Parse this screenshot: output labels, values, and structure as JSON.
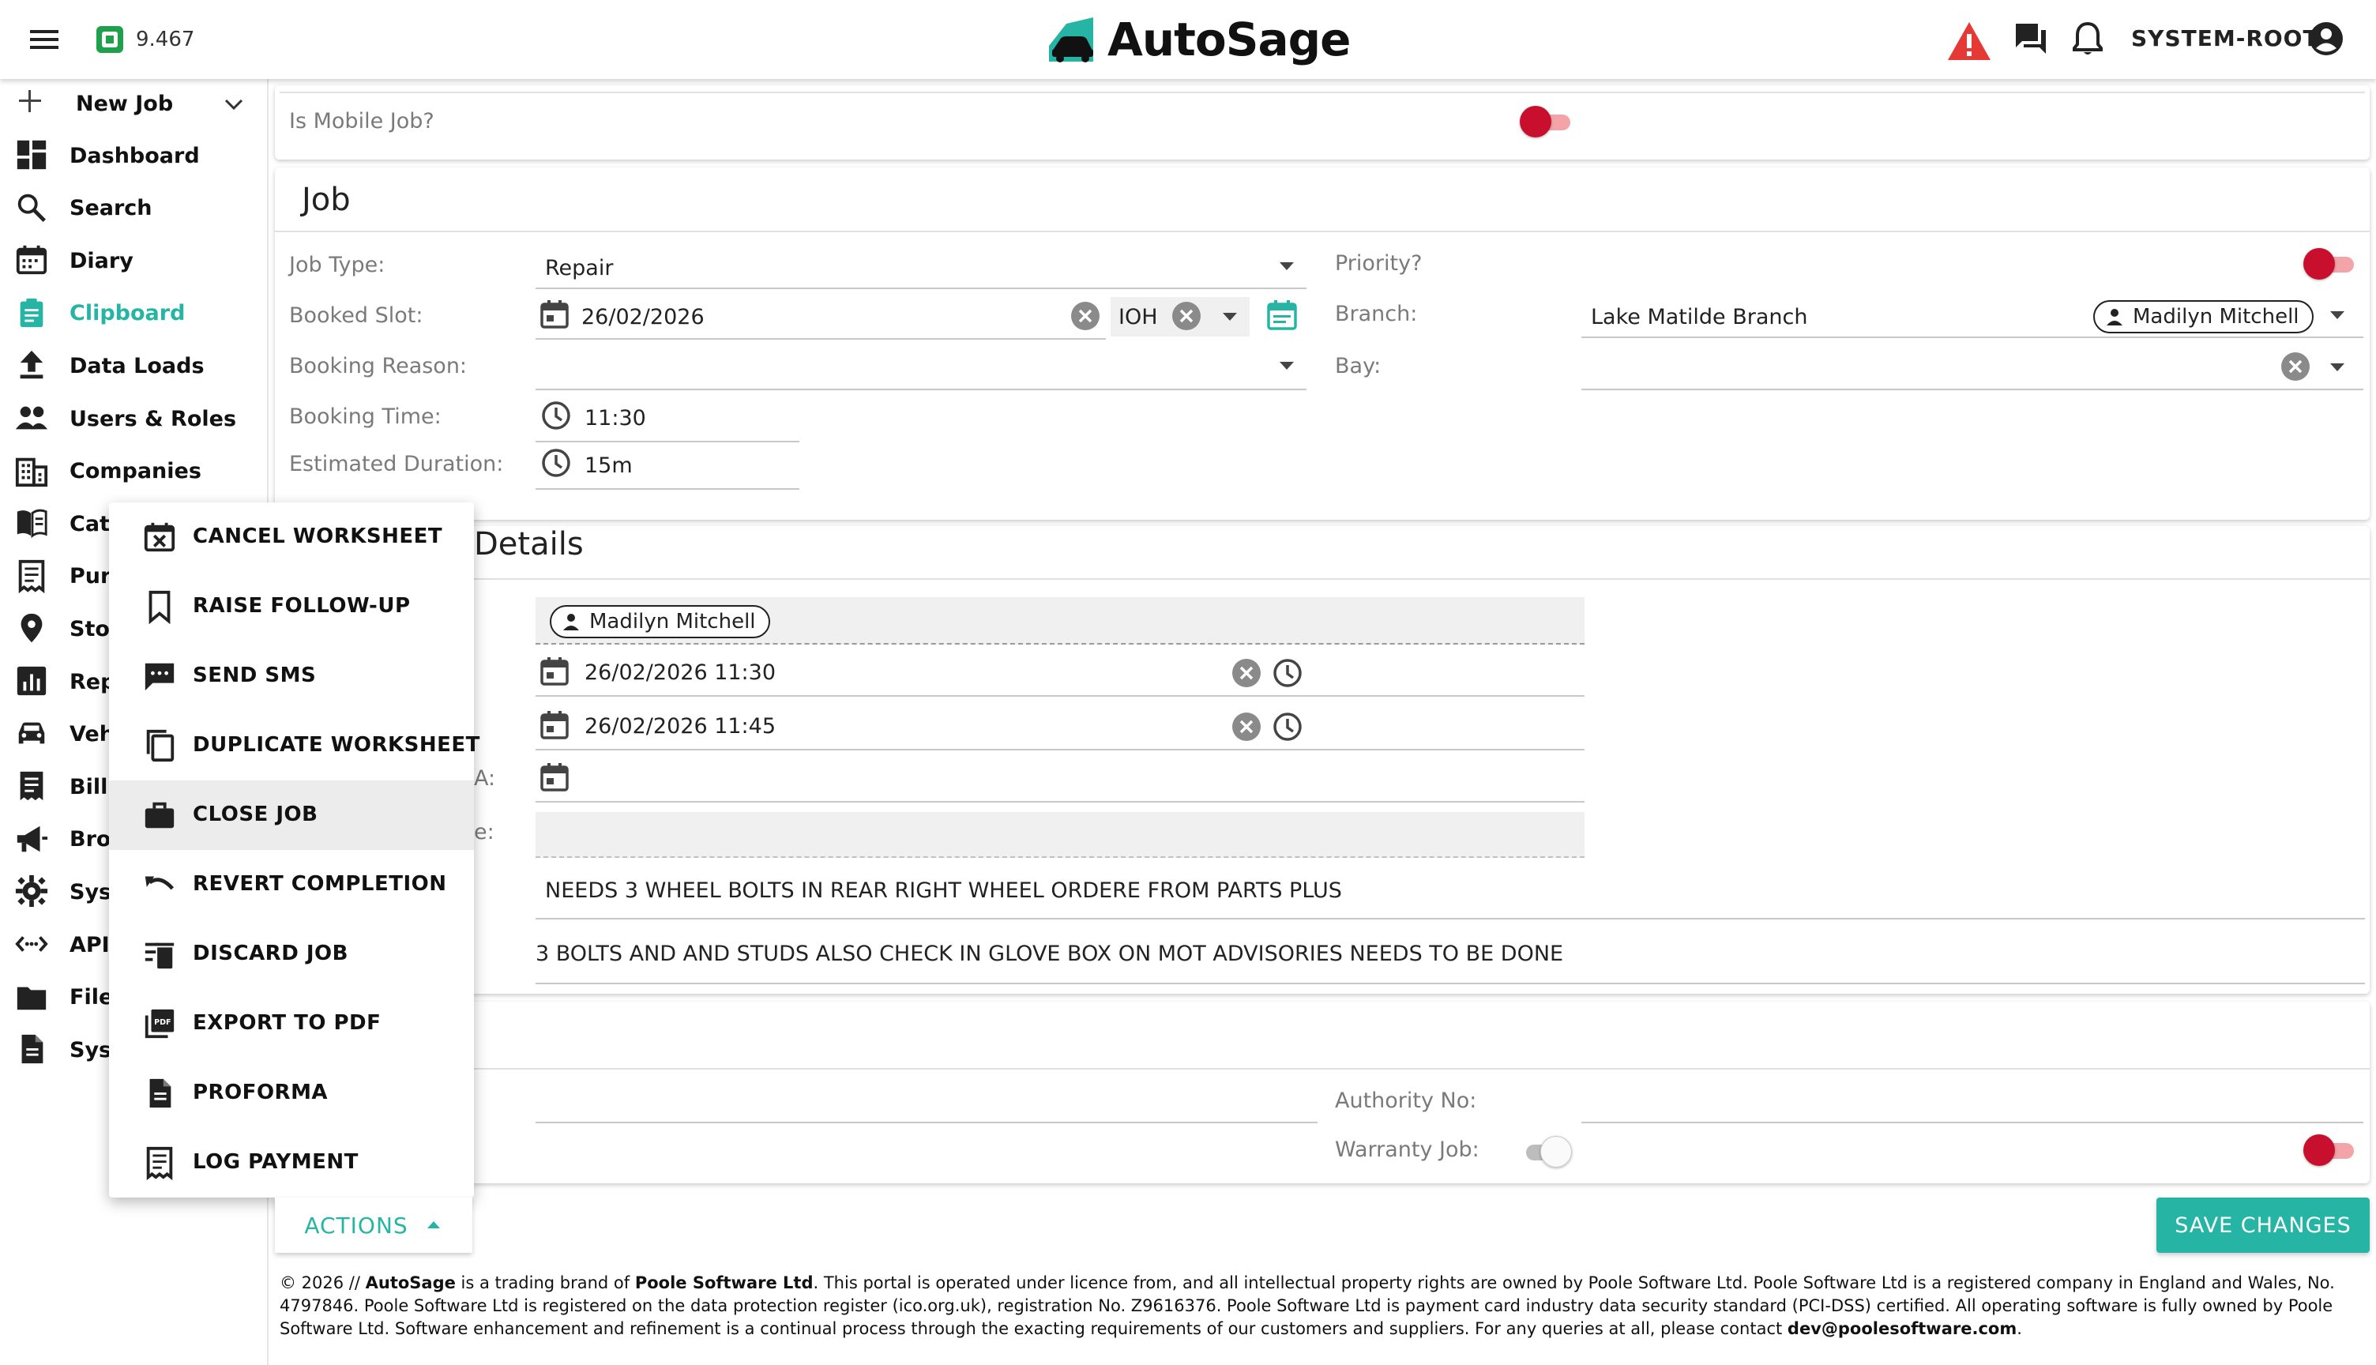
{
  "header": {
    "credit_balance": "9.467",
    "brand": "AutoSage",
    "username": "SYSTEM-ROOT",
    "icons": [
      "menu-icon",
      "credit-icon",
      "warning-icon",
      "messages-icon",
      "bell-icon",
      "account-icon"
    ],
    "warning_color": "#e53935"
  },
  "sidebar": {
    "new_job": "New Job",
    "items": [
      {
        "label": "Dashboard",
        "icon": "dashboard-icon"
      },
      {
        "label": "Search",
        "icon": "search-icon"
      },
      {
        "label": "Diary",
        "icon": "calendar-icon"
      },
      {
        "label": "Clipboard",
        "icon": "clipboard-icon",
        "active": true
      },
      {
        "label": "Data Loads",
        "icon": "upload-icon"
      },
      {
        "label": "Users & Roles",
        "icon": "people-icon"
      },
      {
        "label": "Companies",
        "icon": "building-icon"
      },
      {
        "label": "Cata",
        "icon": "catalog-icon"
      },
      {
        "label": "Purc",
        "icon": "receipt-icon"
      },
      {
        "label": "Stoc",
        "icon": "location-icon"
      },
      {
        "label": "Repo",
        "icon": "report-icon"
      },
      {
        "label": "Vehi",
        "icon": "car-icon"
      },
      {
        "label": "Billin",
        "icon": "billing-icon"
      },
      {
        "label": "Broa",
        "icon": "megaphone-icon"
      },
      {
        "label": "Syst",
        "icon": "gear-icon"
      },
      {
        "label": "API",
        "icon": "api-icon"
      },
      {
        "label": "Files",
        "icon": "folder-icon"
      },
      {
        "label": "Syst",
        "icon": "document-icon"
      }
    ],
    "accent": "#26b5a4"
  },
  "mobile": {
    "label": "Is Mobile Job?"
  },
  "job": {
    "title": "Job",
    "job_type_label": "Job Type:",
    "job_type_value": "Repair",
    "booked_slot_label": "Booked Slot:",
    "booked_slot_value": "26/02/2026",
    "slot_code": "IOH",
    "booking_reason_label": "Booking Reason:",
    "booking_time_label": "Booking Time:",
    "booking_time_value": "11:30",
    "estimated_duration_label": "Estimated Duration:",
    "estimated_duration_value": "15m",
    "priority_label": "Priority?",
    "branch_label": "Branch:",
    "branch_value": "Lake Matilde Branch",
    "branch_chip": "Madilyn Mitchell",
    "bay_label": "Bay:"
  },
  "details": {
    "title": "Details",
    "assignee_chip": "Madilyn Mitchell",
    "start_value": "26/02/2026 11:30",
    "end_value": "26/02/2026 11:45",
    "partial_label_a": "A:",
    "partial_label_e": "e:",
    "note_1": "NEEDS 3 WHEEL BOLTS IN REAR RIGHT WHEEL ORDERE FROM PARTS PLUS",
    "note_2": "3 BOLTS AND AND STUDS ALSO CHECK IN GLOVE BOX ON MOT ADVISORIES NEEDS TO BE DONE"
  },
  "authority": {
    "authority_label": "Authority No:",
    "warranty_label": "Warranty Job:"
  },
  "actions_menu": {
    "items": [
      {
        "label": "CANCEL WORKSHEET",
        "icon": "calendar-x-icon"
      },
      {
        "label": "RAISE FOLLOW-UP",
        "icon": "bookmark-icon"
      },
      {
        "label": "SEND SMS",
        "icon": "sms-icon"
      },
      {
        "label": "DUPLICATE WORKSHEET",
        "icon": "copy-icon"
      },
      {
        "label": "CLOSE JOB",
        "icon": "briefcase-icon",
        "highlighted": true
      },
      {
        "label": "REVERT COMPLETION",
        "icon": "undo-icon"
      },
      {
        "label": "DISCARD JOB",
        "icon": "delete-sweep-icon"
      },
      {
        "label": "EXPORT TO PDF",
        "icon": "pdf-icon"
      },
      {
        "label": "PROFORMA",
        "icon": "document-icon"
      },
      {
        "label": "LOG PAYMENT",
        "icon": "receipt-icon"
      }
    ]
  },
  "buttons": {
    "actions": "ACTIONS",
    "save": "SAVE CHANGES"
  },
  "footer": {
    "p1": "© 2026 // ",
    "brand": "AutoSage",
    "p2": " is a trading brand of ",
    "company": "Poole Software Ltd",
    "p3": ". This portal is operated under licence from, and all intellectual property rights are owned by Poole Software Ltd. Poole Software Ltd is a registered company in England and Wales, No. 4797846. Poole Software Ltd is registered on the data protection register (ico.org.uk), registration No. Z9616376. Poole Software Ltd is payment card industry data security standard (PCI-DSS) certified. All operating software is fully owned by Poole Software Ltd. Software enhancement and refinement is a continual process through the exacting requirements of our customers and suppliers. For any queries at all, please contact ",
    "email": "dev@poolesoftware.com",
    "p4": "."
  }
}
